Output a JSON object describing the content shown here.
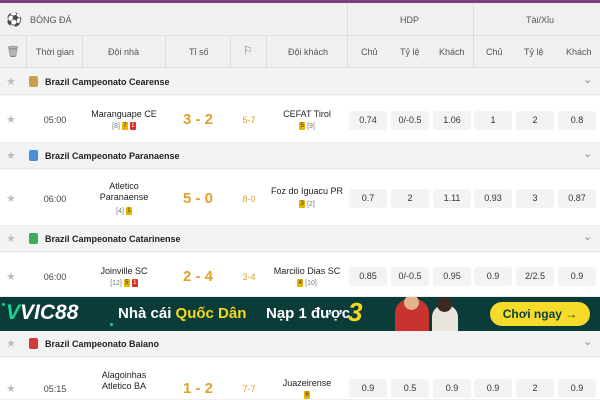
{
  "header": {
    "sport_title": "BÓNG ĐÁ",
    "hdp_group": "HDP",
    "ou_group": "Tài/Xỉu",
    "columns": {
      "time": "Thời gian",
      "home": "Đội nhà",
      "score": "Tỉ số",
      "away": "Đội khách",
      "hdp_home": "Chủ",
      "hdp_ratio": "Tỷ lệ",
      "hdp_away": "Khách",
      "ou_home": "Chủ",
      "ou_ratio": "Tỷ lệ",
      "ou_away": "Khách"
    }
  },
  "leagues": [
    {
      "name": "Brazil Campeonato Cearense",
      "flag_color": "#c8a24a",
      "match": {
        "time": "05:00",
        "home": "Maranguape CE",
        "home_rank": "[8]",
        "home_cards": [
          "7",
          "1"
        ],
        "score": "3 - 2",
        "corners": "5-7",
        "away": "CEFAT Tirol",
        "away_cards": [
          "5"
        ],
        "away_rank": "[9]",
        "odds": [
          "0.74",
          "0/-0.5",
          "1.06",
          "1",
          "2",
          "0.8"
        ]
      }
    },
    {
      "name": "Brazil Campeonato Paranaense",
      "flag_color": "#4a8ed8",
      "match": {
        "time": "06:00",
        "home": "Atletico Paranaense",
        "home_rank": "[4]",
        "home_cards": [
          "1"
        ],
        "score": "5 - 0",
        "corners": "8-0",
        "away": "Foz do Iguacu PR",
        "away_cards": [
          "3"
        ],
        "away_rank": "[2]",
        "odds": [
          "0.7",
          "2",
          "1.11",
          "0.93",
          "3",
          "0.87"
        ]
      }
    },
    {
      "name": "Brazil Campeonato Catarinense",
      "flag_color": "#3fae5a",
      "match": {
        "time": "06:00",
        "home": "Joinville SC",
        "home_rank": "[12]",
        "home_cards": [
          "5",
          "1"
        ],
        "score": "2 - 4",
        "corners": "3-4",
        "away": "Marcilio Dias SC",
        "away_cards": [
          "4"
        ],
        "away_rank": "[10]",
        "odds": [
          "0.85",
          "0/-0.5",
          "0.95",
          "0.9",
          "2/2.5",
          "0.9"
        ]
      }
    },
    {
      "name": "Brazil Campeonato Baiano",
      "flag_color": "#d23a3a",
      "match": {
        "time": "05:15",
        "home": "Alagoinhas Atletico BA",
        "score": "1 - 2",
        "corners": "7-7",
        "away": "Juazeirense",
        "away_cards": [
          "6"
        ],
        "odds": [
          "0.9",
          "0.5",
          "0.9",
          "0.9",
          "2",
          "0.9"
        ]
      }
    }
  ],
  "banner": {
    "brand": "VIC88",
    "slogan_a": "Nhà cái",
    "slogan_b": "Quốc Dân",
    "promo": "Nạp 1 được",
    "promo_num": "3",
    "cta": "Chơi ngay →"
  }
}
